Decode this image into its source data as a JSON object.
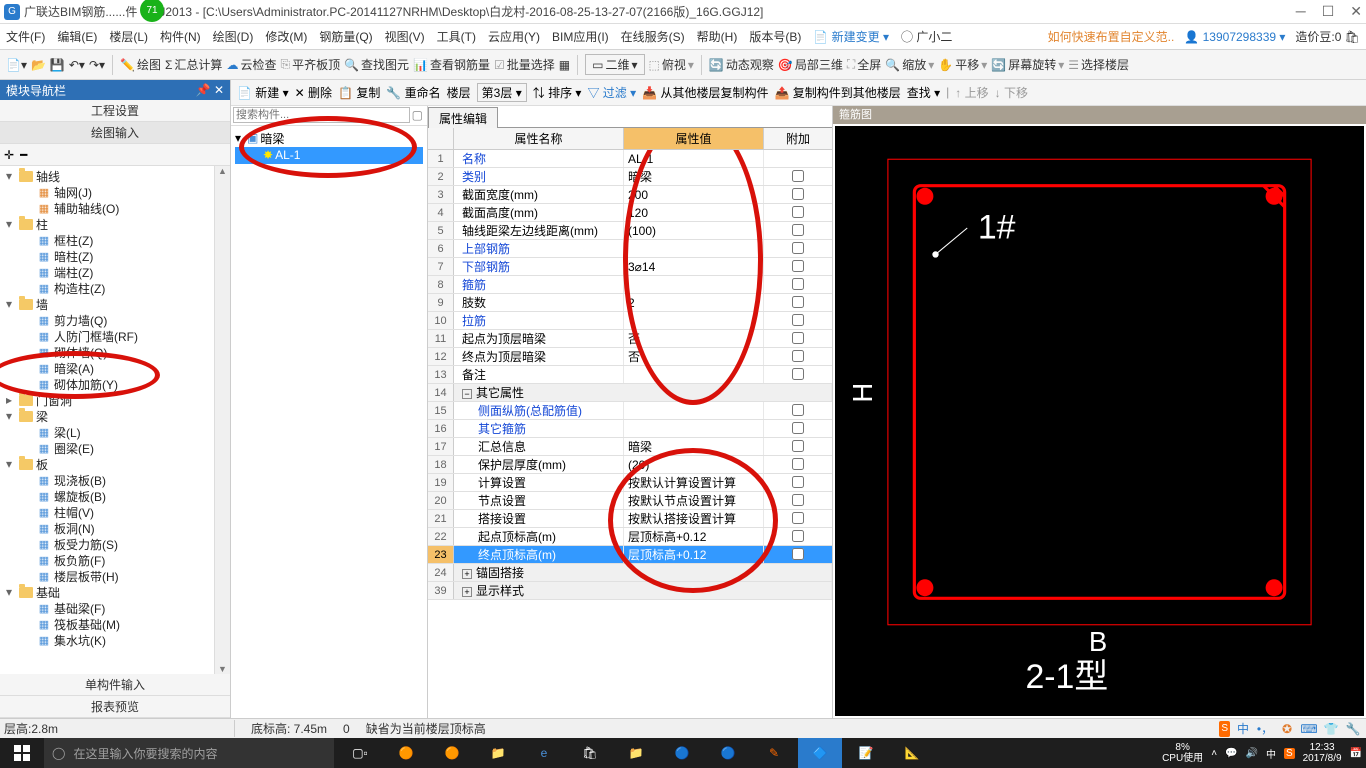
{
  "titlebar": {
    "badge": "71",
    "title": "广联达BIM钢筋......件 GGJ2013 - [C:\\Users\\Administrator.PC-20141127NRHM\\Desktop\\白龙村-2016-08-25-13-27-07(2166版)_16G.GGJ12]"
  },
  "menubar": {
    "items": [
      "文件(F)",
      "编辑(E)",
      "楼层(L)",
      "构件(N)",
      "绘图(D)",
      "修改(M)",
      "钢筋量(Q)",
      "视图(V)",
      "工具(T)",
      "云应用(Y)",
      "BIM应用(I)",
      "在线服务(S)",
      "帮助(H)",
      "版本号(B)"
    ],
    "new_change": "新建变更",
    "user": "广小二",
    "tip": "如何快速布置自定义范..",
    "account": "13907298339",
    "credit_label": "造价豆:0"
  },
  "toolbar1": {
    "items": [
      "绘图",
      "汇总计算",
      "云检查",
      "平齐板顶",
      "查找图元",
      "查看钢筋量",
      "批量选择",
      "二维",
      "俯视",
      "动态观察",
      "局部三维",
      "全屏",
      "缩放",
      "平移",
      "屏幕旋转",
      "选择楼层"
    ]
  },
  "sidebar": {
    "header": "模块导航栏",
    "tabs": [
      "工程设置",
      "绘图输入"
    ],
    "bottom_tabs": [
      "单构件输入",
      "报表预览"
    ],
    "tree": [
      {
        "l": 0,
        "exp": "▾",
        "ico": "folder",
        "t": "轴线"
      },
      {
        "l": 1,
        "ico": "grid",
        "t": "轴网(J)"
      },
      {
        "l": 1,
        "ico": "grid",
        "t": "辅助轴线(O)"
      },
      {
        "l": 0,
        "exp": "▾",
        "ico": "folder",
        "t": "柱"
      },
      {
        "l": 1,
        "ico": "col",
        "t": "框柱(Z)"
      },
      {
        "l": 1,
        "ico": "col",
        "t": "暗柱(Z)"
      },
      {
        "l": 1,
        "ico": "col",
        "t": "端柱(Z)"
      },
      {
        "l": 1,
        "ico": "col",
        "t": "构造柱(Z)"
      },
      {
        "l": 0,
        "exp": "▾",
        "ico": "folder",
        "t": "墙"
      },
      {
        "l": 1,
        "ico": "wall",
        "t": "剪力墙(Q)"
      },
      {
        "l": 1,
        "ico": "wall",
        "t": "人防门框墙(RF)"
      },
      {
        "l": 1,
        "ico": "wall",
        "t": "砌体墙(Q)"
      },
      {
        "l": 1,
        "ico": "wall",
        "t": "暗梁(A)"
      },
      {
        "l": 1,
        "ico": "wall",
        "t": "砌体加筋(Y)"
      },
      {
        "l": 0,
        "exp": "▸",
        "ico": "folder",
        "t": "门窗洞"
      },
      {
        "l": 0,
        "exp": "▾",
        "ico": "folder",
        "t": "梁"
      },
      {
        "l": 1,
        "ico": "beam",
        "t": "梁(L)"
      },
      {
        "l": 1,
        "ico": "beam",
        "t": "圈梁(E)"
      },
      {
        "l": 0,
        "exp": "▾",
        "ico": "folder",
        "t": "板"
      },
      {
        "l": 1,
        "ico": "slab",
        "t": "现浇板(B)"
      },
      {
        "l": 1,
        "ico": "slab",
        "t": "螺旋板(B)"
      },
      {
        "l": 1,
        "ico": "slab",
        "t": "柱帽(V)"
      },
      {
        "l": 1,
        "ico": "slab",
        "t": "板洞(N)"
      },
      {
        "l": 1,
        "ico": "slab",
        "t": "板受力筋(S)"
      },
      {
        "l": 1,
        "ico": "slab",
        "t": "板负筋(F)"
      },
      {
        "l": 1,
        "ico": "slab",
        "t": "楼层板带(H)"
      },
      {
        "l": 0,
        "exp": "▾",
        "ico": "folder",
        "t": "基础"
      },
      {
        "l": 1,
        "ico": "fnd",
        "t": "基础梁(F)"
      },
      {
        "l": 1,
        "ico": "fnd",
        "t": "筏板基础(M)"
      },
      {
        "l": 1,
        "ico": "fnd",
        "t": "集水坑(K)"
      }
    ]
  },
  "toolbar2": {
    "items": [
      "新建",
      "删除",
      "复制",
      "重命名",
      "楼层",
      "第3层"
    ],
    "sort": "排序",
    "filter": "过滤",
    "copy_from": "从其他楼层复制构件",
    "copy_to": "复制构件到其他楼层",
    "find": "查找",
    "up": "上移",
    "down": "下移"
  },
  "model_tree": {
    "search_placeholder": "搜索构件...",
    "root": "暗梁",
    "item": "AL-1"
  },
  "prop": {
    "tab": "属性编辑",
    "headers": [
      "属性名称",
      "属性值",
      "附加"
    ],
    "rows": [
      {
        "n": "1",
        "name": "名称",
        "blue": true,
        "val": "AL-1",
        "cb": false
      },
      {
        "n": "2",
        "name": "类别",
        "blue": true,
        "val": "暗梁",
        "cb": true
      },
      {
        "n": "3",
        "name": "截面宽度(mm)",
        "val": "200",
        "cb": true
      },
      {
        "n": "4",
        "name": "截面高度(mm)",
        "val": "120",
        "cb": true
      },
      {
        "n": "5",
        "name": "轴线距梁左边线距离(mm)",
        "val": "(100)",
        "cb": true
      },
      {
        "n": "6",
        "name": "上部钢筋",
        "blue": true,
        "val": "",
        "cb": true
      },
      {
        "n": "7",
        "name": "下部钢筋",
        "blue": true,
        "val": "3⌀14",
        "cb": true
      },
      {
        "n": "8",
        "name": "箍筋",
        "blue": true,
        "val": "",
        "cb": true
      },
      {
        "n": "9",
        "name": "肢数",
        "val": "2",
        "cb": true
      },
      {
        "n": "10",
        "name": "拉筋",
        "blue": true,
        "val": "",
        "cb": true
      },
      {
        "n": "11",
        "name": "起点为顶层暗梁",
        "val": "否",
        "cb": true
      },
      {
        "n": "12",
        "name": "终点为顶层暗梁",
        "val": "否",
        "cb": true
      },
      {
        "n": "13",
        "name": "备注",
        "val": "",
        "cb": true
      },
      {
        "n": "14",
        "name": "其它属性",
        "group": true
      },
      {
        "n": "15",
        "name": "侧面纵筋(总配筋值)",
        "blue": true,
        "indent": true,
        "val": "",
        "cb": true
      },
      {
        "n": "16",
        "name": "其它箍筋",
        "blue": true,
        "indent": true,
        "val": "",
        "cb": true
      },
      {
        "n": "17",
        "name": "汇总信息",
        "indent": true,
        "val": "暗梁",
        "cb": true
      },
      {
        "n": "18",
        "name": "保护层厚度(mm)",
        "indent": true,
        "val": "(20)",
        "cb": true
      },
      {
        "n": "19",
        "name": "计算设置",
        "indent": true,
        "val": "按默认计算设置计算",
        "cb": true
      },
      {
        "n": "20",
        "name": "节点设置",
        "indent": true,
        "val": "按默认节点设置计算",
        "cb": true
      },
      {
        "n": "21",
        "name": "搭接设置",
        "indent": true,
        "val": "按默认搭接设置计算",
        "cb": true
      },
      {
        "n": "22",
        "name": "起点顶标高(m)",
        "indent": true,
        "val": "层顶标高+0.12",
        "cb": true
      },
      {
        "n": "23",
        "name": "终点顶标高(m)",
        "indent": true,
        "val": "层顶标高+0.12",
        "cb": true,
        "sel": true
      },
      {
        "n": "24",
        "name": "锚固搭接",
        "group": true,
        "plus": true
      },
      {
        "n": "39",
        "name": "显示样式",
        "group": true,
        "plus": true
      }
    ]
  },
  "preview": {
    "header": "箍筋图",
    "label1": "1#",
    "labelH": "H",
    "labelB": "B",
    "labelType": "2-1型"
  },
  "statusbar": {
    "floor_h": "层高:2.8m",
    "bottom_h": "底标高: 7.45m",
    "hint": "缺省为当前楼层顶标高"
  },
  "taskbar": {
    "search": "在这里输入你要搜索的内容",
    "cpu_pct": "8%",
    "cpu_label": "CPU使用",
    "time": "12:33",
    "date": "2017/8/9"
  }
}
